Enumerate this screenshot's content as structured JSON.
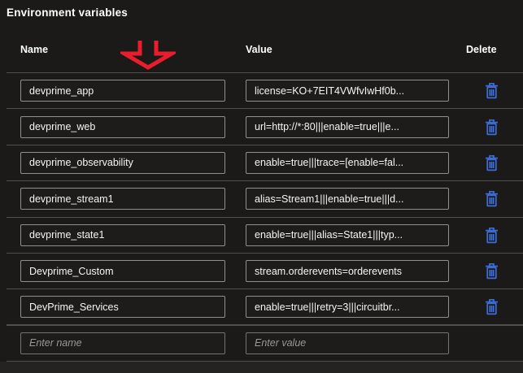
{
  "page": {
    "title": "Environment variables"
  },
  "table": {
    "headers": {
      "name": "Name",
      "value": "Value",
      "delete": "Delete"
    },
    "rows": [
      {
        "name": "devprime_app",
        "value": "license=KO+7EIT4VWfvIwHf0b..."
      },
      {
        "name": "devprime_web",
        "value": "url=http://*:80|||enable=true|||e..."
      },
      {
        "name": "devprime_observability",
        "value": "enable=true|||trace=[enable=fal..."
      },
      {
        "name": "devprime_stream1",
        "value": "alias=Stream1|||enable=true|||d..."
      },
      {
        "name": "devprime_state1",
        "value": "enable=true|||alias=State1|||typ..."
      },
      {
        "name": "Devprime_Custom",
        "value": "stream.orderevents=orderevents"
      },
      {
        "name": "DevPrime_Services",
        "value": "enable=true|||retry=3|||circuitbr..."
      }
    ],
    "new_row": {
      "name_placeholder": "Enter name",
      "value_placeholder": "Enter value"
    }
  },
  "icons": {
    "delete": "trash-icon"
  },
  "annotation": {
    "type": "red-down-arrow"
  },
  "colors": {
    "background": "#1b1a19",
    "separator": "#4f4e4d",
    "input_border": "#8f8f8f",
    "delete_icon_blue": "#3d6ed8",
    "annotation_red": "#e91d2c",
    "text": "#f5f5f5",
    "placeholder": "#9a9896"
  }
}
